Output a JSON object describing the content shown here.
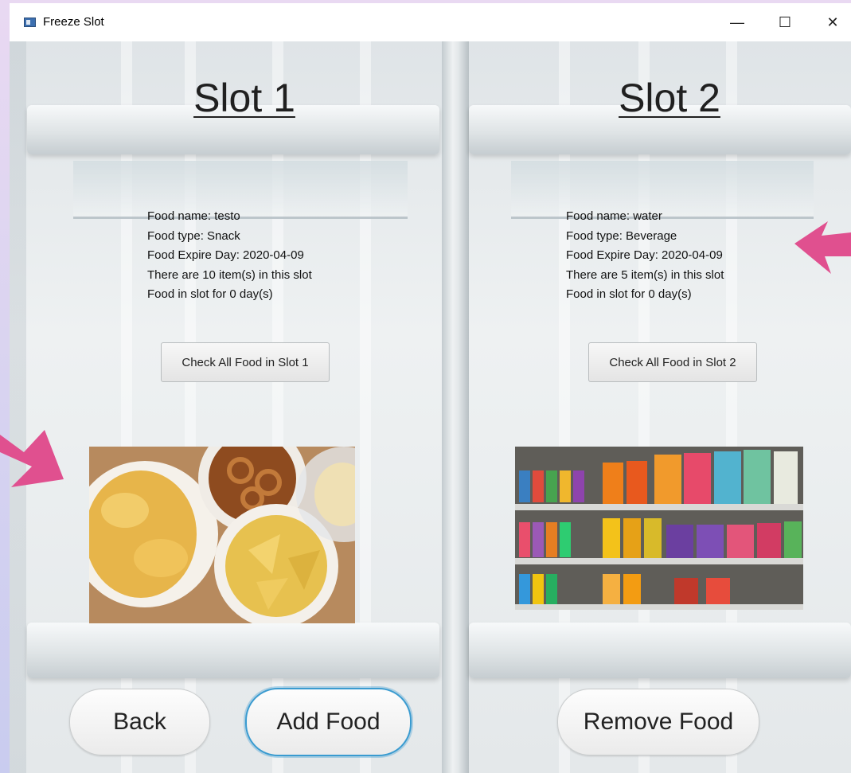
{
  "window": {
    "title": "Freeze Slot",
    "controls": {
      "minimize": "—",
      "maximize": "☐",
      "close": "✕"
    }
  },
  "slots": [
    {
      "title": "Slot 1",
      "info": [
        "Food name: testo",
        "Food type: Snack",
        "Food Expire Day: 2020-04-09",
        "There are 10 item(s) in this slot",
        "Food in slot for 0 day(s)"
      ],
      "check_button": "Check All Food in Slot 1",
      "image_icon": "snack-photo"
    },
    {
      "title": "Slot 2",
      "info": [
        "Food name: water",
        "Food type: Beverage",
        "Food Expire Day: 2020-04-09",
        "There are 5 item(s) in this slot",
        "Food in slot for 0 day(s)"
      ],
      "check_button": "Check All Food in Slot 2",
      "image_icon": "beverage-shelf-photo"
    }
  ],
  "buttons": {
    "back": "Back",
    "add_food": "Add Food",
    "remove_food": "Remove Food"
  },
  "colors": {
    "arrow": "#e0508f",
    "focus_ring": "#3a9bd0"
  }
}
